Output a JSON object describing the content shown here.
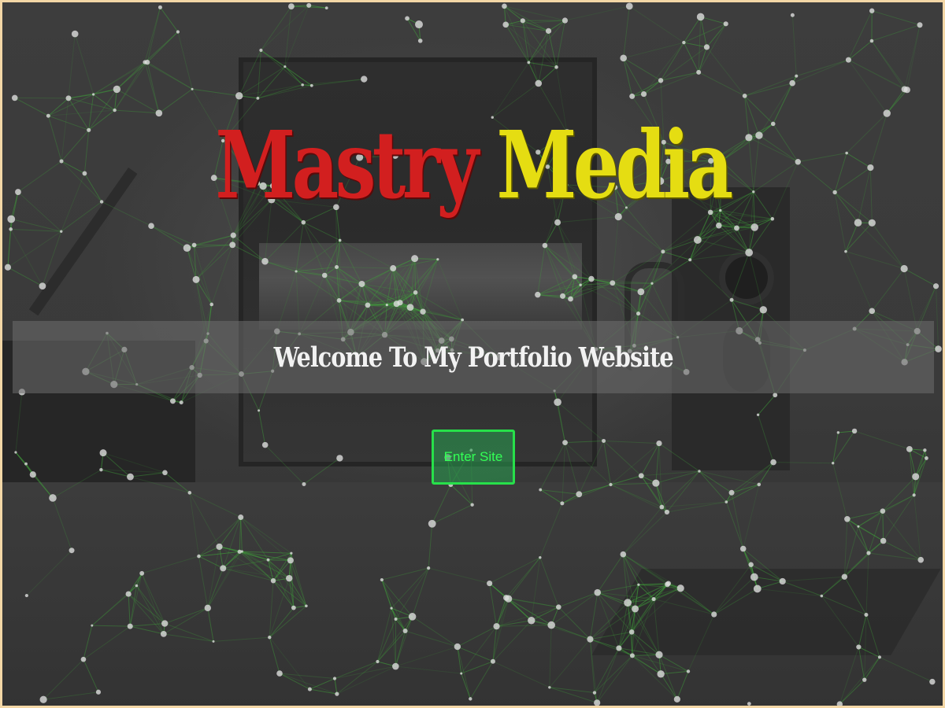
{
  "hero": {
    "title_word_1": "Mastry",
    "title_word_2": "Media",
    "welcome_text": "Welcome To My Portfolio Website",
    "enter_button_label": "Enter Site"
  },
  "colors": {
    "title_word_1": "#d21f1f",
    "title_word_2": "#e5dd12",
    "button_border": "#27e04a",
    "button_text": "#33ff55",
    "network_lines": "#3fa43a",
    "network_nodes": "#dddddd",
    "page_border": "#f3d7a6"
  },
  "background": {
    "description_icon": "studio-desk-photo",
    "overlay": "network-plexus-animation"
  }
}
